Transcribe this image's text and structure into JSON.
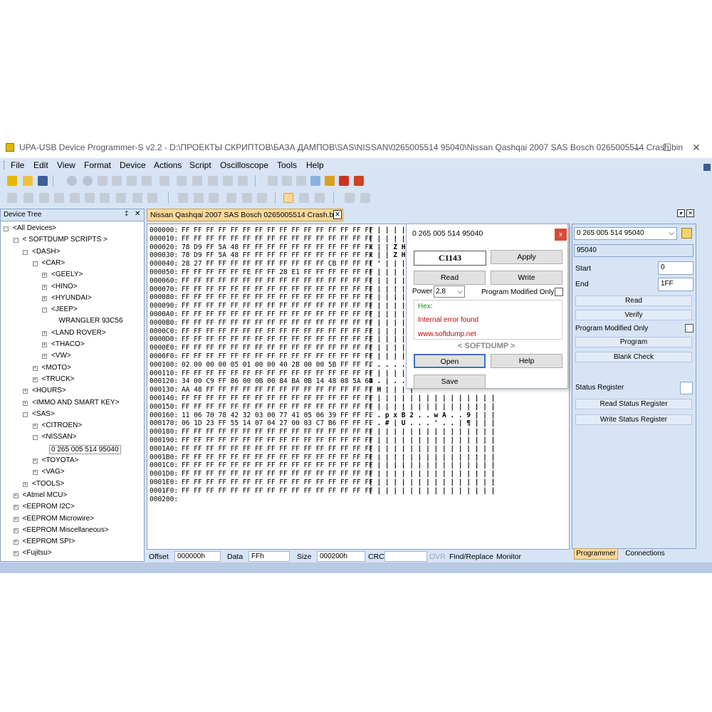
{
  "window": {
    "title": "UPA-USB Device Programmer-S v2.2 - D:\\ПРОЕКТЫ СКРИПТОВ\\БАЗА ДАМПОВ\\SAS\\NISSAN\\0265005514 95040\\Nissan Qashqai 2007 SAS Bosch 0265005514 Crash.bin",
    "minimize": "—",
    "maximize": "☐",
    "close": "✕"
  },
  "menu": [
    "File",
    "Edit",
    "View",
    "Format",
    "Device",
    "Actions",
    "Script",
    "Oscilloscope",
    "Tools",
    "Help"
  ],
  "device_tree": {
    "title": "Device Tree",
    "pin": "‡",
    "close": "✕",
    "items": [
      {
        "label": "<All Devices>",
        "sign": "-"
      },
      {
        "label": "< SOFTDUMP SCRIPTS >",
        "sign": "-"
      },
      {
        "label": "<DASH>",
        "sign": "-"
      },
      {
        "label": "<CAR>",
        "sign": "-"
      },
      {
        "label": "<GEELY>",
        "sign": "+"
      },
      {
        "label": "<HINO>",
        "sign": "+"
      },
      {
        "label": "<HYUNDAI>",
        "sign": "+"
      },
      {
        "label": "<JEEP>",
        "sign": "-"
      },
      {
        "label": "WRANGLER 93C56",
        "sign": ""
      },
      {
        "label": "<LAND ROVER>",
        "sign": "+"
      },
      {
        "label": "<THACO>",
        "sign": "+"
      },
      {
        "label": "<VW>",
        "sign": "+"
      },
      {
        "label": "<MOTO>",
        "sign": "+"
      },
      {
        "label": "<TRUCK>",
        "sign": "+"
      },
      {
        "label": "<HOURS>",
        "sign": "+"
      },
      {
        "label": "<IMMO AND SMART KEY>",
        "sign": "+"
      },
      {
        "label": "<SAS>",
        "sign": "-"
      },
      {
        "label": "<CITROEN>",
        "sign": "+"
      },
      {
        "label": "<NISSAN>",
        "sign": "-"
      },
      {
        "label": "0 265 005 514 95040",
        "sign": ""
      },
      {
        "label": "<TOYOTA>",
        "sign": "+"
      },
      {
        "label": "<VAG>",
        "sign": "+"
      },
      {
        "label": "<TOOLS>",
        "sign": "+"
      },
      {
        "label": "<Atmel MCU>",
        "sign": "+"
      },
      {
        "label": "<EEPROM I2C>",
        "sign": "+"
      },
      {
        "label": "<EEPROM Microwire>",
        "sign": "+"
      },
      {
        "label": "<EEPROM Miscellaneous>",
        "sign": "+"
      },
      {
        "label": "<EEPROM SPI>",
        "sign": "+"
      },
      {
        "label": "<Fujitsu>",
        "sign": "+"
      }
    ]
  },
  "tab": {
    "label": "Nissan Qashqai 2007 SAS Bosch 0265005514 Crash.bin",
    "close": "✕"
  },
  "hex": {
    "rows": [
      {
        "addr": "000000:",
        "bytes": "FF FF FF FF FF FF FF FF FF FF FF FF FF FF FF FF",
        "ascii": "| | | | | |"
      },
      {
        "addr": "000010:",
        "bytes": "FF FF FF FF FF FF FF FF FF FF FF FF FF FF FF FF",
        "ascii": "| | | | | |"
      },
      {
        "addr": "000020:",
        "bytes": "78 D9 FF 5A 48 FF FF FF FF FF FF FF FF FF FF FF",
        "ascii": "x | | Z H"
      },
      {
        "addr": "000030:",
        "bytes": "78 D9 FF 5A 48 FF FF FF FF FF FF FF FF FF FF FF",
        "ascii": "x | | Z H"
      },
      {
        "addr": "000040:",
        "bytes": "28 27 FF FF FF FF FF FF FF FF FF FF CB FF FF FF",
        "ascii": "( ' | | | |"
      },
      {
        "addr": "000050:",
        "bytes": "FF FF FF FF FF FE FF FF 28 E1 FF FF FF FF FF FF",
        "ascii": "| | | | | |"
      },
      {
        "addr": "000060:",
        "bytes": "FF FF FF FF FF FF FF FF FF FF FF FF FF FF FF FF",
        "ascii": "| | | | | |"
      },
      {
        "addr": "000070:",
        "bytes": "FF FF FF FF FF FF FF FF FF FF FF FF FF FF FF FF",
        "ascii": "| | | | | |"
      },
      {
        "addr": "000080:",
        "bytes": "FF FF FF FF FF FF FF FF FF FF FF FF FF FF FF FF",
        "ascii": "| | | | | |"
      },
      {
        "addr": "000090:",
        "bytes": "FF FF FF FF FF FF FF FF FF FF FF FF FF FF FF FF",
        "ascii": "| | | | | |"
      },
      {
        "addr": "0000A0:",
        "bytes": "FF FF FF FF FF FF FF FF FF FF FF FF FF FF FF FF",
        "ascii": "| | | | | |"
      },
      {
        "addr": "0000B0:",
        "bytes": "FF FF FF FF FF FF FF FF FF FF FF FF FF FF FF FF",
        "ascii": "| | | | | |"
      },
      {
        "addr": "0000C0:",
        "bytes": "FF FF FF FF FF FF FF FF FF FF FF FF FF FF FF FF",
        "ascii": "| | | | | |"
      },
      {
        "addr": "0000D0:",
        "bytes": "FF FF FF FF FF FF FF FF FF FF FF FF FF FF FF FF",
        "ascii": "| | | | | |"
      },
      {
        "addr": "0000E0:",
        "bytes": "FF FF FF FF FF FF FF FF FF FF FF FF FF FF FF FF",
        "ascii": "| | | | | |"
      },
      {
        "addr": "0000F0:",
        "bytes": "FF FF FF FF FF FF FF FF FF FF FF FF FF FF FF FF",
        "ascii": "| | | | | |"
      },
      {
        "addr": "000100:",
        "bytes": "02 00 00 00 05 01 00 00 40 2B 00 00 5B FF FF FF",
        "ascii": ". . . . . ."
      },
      {
        "addr": "000110:",
        "bytes": "FF FF FF FF FF FF FF FF FF FF FF FF FF FF FF FF",
        "ascii": "| | | | | |"
      },
      {
        "addr": "000120:",
        "bytes": "34 00 C9 FF 86 00 0B 00 84 BA 0B 14 48 08 5A 6B",
        "ascii": "4 . | . ."
      },
      {
        "addr": "000130:",
        "bytes": "AA 48 FF FF FF FF FF FF FF FF FF FF FF FF FF FF",
        "ascii": "| H | | | |"
      },
      {
        "addr": "000140:",
        "bytes": "FF FF FF FF FF FF FF FF FF FF FF FF FF FF FF FF",
        "ascii": "| | | | | | | | | | | | | | | |"
      },
      {
        "addr": "000150:",
        "bytes": "FF FF FF FF FF FF FF FF FF FF FF FF FF FF FF FF",
        "ascii": "| | | | | | | | | | | | | | | |"
      },
      {
        "addr": "000160:",
        "bytes": "11 06 70 78 42 32 03 00 77 41 05 06 39 FF FF FF",
        "ascii": ". . p x B 2 . . w A . . 9 | | |"
      },
      {
        "addr": "000170:",
        "bytes": "06 1D 23 FF 55 14 07 04 27 00 03 C7 B6 FF FF FF",
        "ascii": ". . # | U . . . ' . . | ¶ | | |"
      },
      {
        "addr": "000180:",
        "bytes": "FF FF FF FF FF FF FF FF FF FF FF FF FF FF FF FF",
        "ascii": "| | | | | | | | | | | | | | | |"
      },
      {
        "addr": "000190:",
        "bytes": "FF FF FF FF FF FF FF FF FF FF FF FF FF FF FF FF",
        "ascii": "| | | | | | | | | | | | | | | |"
      },
      {
        "addr": "0001A0:",
        "bytes": "FF FF FF FF FF FF FF FF FF FF FF FF FF FF FF FF",
        "ascii": "| | | | | | | | | | | | | | | |"
      },
      {
        "addr": "0001B0:",
        "bytes": "FF FF FF FF FF FF FF FF FF FF FF FF FF FF FF FF",
        "ascii": "| | | | | | | | | | | | | | | |"
      },
      {
        "addr": "0001C0:",
        "bytes": "FF FF FF FF FF FF FF FF FF FF FF FF FF FF FF FF",
        "ascii": "| | | | | | | | | | | | | | | |"
      },
      {
        "addr": "0001D0:",
        "bytes": "FF FF FF FF FF FF FF FF FF FF FF FF FF FF FF FF",
        "ascii": "| | | | | | | | | | | | | | | |"
      },
      {
        "addr": "0001E0:",
        "bytes": "FF FF FF FF FF FF FF FF FF FF FF FF FF FF FF FF",
        "ascii": "| | | | | | | | | | | | | | | |"
      },
      {
        "addr": "0001F0:",
        "bytes": "FF FF FF FF FF FF FF FF FF FF FF FF FF FF FF FF",
        "ascii": "| | | | | | | | | | | | | | | |"
      },
      {
        "addr": "000200:",
        "bytes": "",
        "ascii": ""
      }
    ]
  },
  "statusbar": {
    "offset_label": "Offset",
    "offset_value": "000000h",
    "data_label": "Data",
    "data_value": "FFh",
    "size_label": "Size",
    "size_value": "000200h",
    "crc_label": "CRC",
    "crc_value": "",
    "ovr": "OVR",
    "find_replace": "Find/Replace",
    "monitor": "Monitor"
  },
  "dialog": {
    "title": "0 265 005 514 95040",
    "close": "x",
    "code": "C1143",
    "apply": "Apply",
    "read": "Read",
    "write": "Write",
    "power_label": "Power",
    "power_value": "2,8",
    "program_modified_only": "Program Modified Only",
    "hex_label": "Hex:",
    "error_text": "Internal error found",
    "url": "www.softdump.net",
    "brand": "< SOFTDUMP >",
    "open": "Open",
    "help": "Help",
    "save": "Save"
  },
  "programmer": {
    "device": "0 265 005 514 95040",
    "device_id": "95040",
    "start_label": "Start",
    "start_value": "0",
    "end_label": "End",
    "end_value": "1FF",
    "read": "Read",
    "verify": "Verify",
    "program_modified_only": "Program Modified Only",
    "program": "Program",
    "blank_check": "Blank Check",
    "status_register": "Status Register",
    "read_status_register": "Read Status Register",
    "write_status_register": "Write Status Register",
    "tab_programmer": "Programmer",
    "tab_connections": "Connections"
  },
  "colors": {
    "error": "#cc0000",
    "hex_label": "#2a8a2a",
    "url": "#cc0000",
    "brand": "#888888",
    "tab_active": "#fdd99b"
  }
}
